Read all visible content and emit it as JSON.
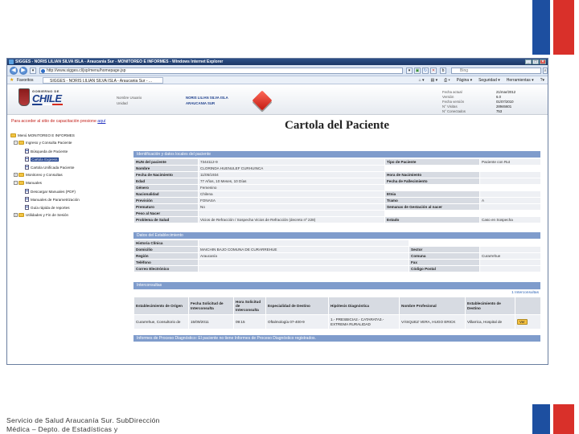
{
  "window": {
    "title": "SIGGES - NORIS LILIAN SILVA ISLA - Araucania Sur - MONITOREO E INFORMES - Windows Internet Explorer",
    "url": "http://www.sigges.cl/jsp/menu/homepage.jsp",
    "search_placeholder": "Bing",
    "mcafee": "McAfee",
    "favorites_label": "Favoritos",
    "tab_title": "SIGGES - NORIS LILIAN SILVA ISLA - Araucania Sur - ...",
    "commands": [
      "Página ▾",
      "Seguridad ▾",
      "Herramientas ▾"
    ]
  },
  "header": {
    "gobierno": "GOBIERNO DE",
    "chile": "CHILE",
    "usuario_label": "Nombre Usuario",
    "unidad_label": "Unidad",
    "usuario_value": "NORIS LILIAN SILVA ISLA",
    "unidad_value": "ARAUCANIA SUR",
    "info_labels": [
      "Fecha actual",
      "Versión",
      "Fecha versión",
      "N° Visitas",
      "N° Conectados"
    ],
    "info_values": [
      "21/mar/2012",
      "6.0",
      "01/07/2010",
      "28946601",
      "753"
    ]
  },
  "sidebar": {
    "capacitacion_text": "Para acceder al sitio de capacitación presione",
    "capacitacion_link": "aquí",
    "menu_title": "Menú MONITOREO E INFORMES",
    "items": [
      "Ingreso y Consulta Paciente",
      "Búsqueda de Paciente",
      "Cartola Express",
      "Cartola Unificada Paciente",
      "Monitoreo y Consultas",
      "Manuales",
      "Descargar Manuales (PDF)",
      "Manuales de Parametrización",
      "Guía rápida de reportes",
      "Utilidades y Fin de Sesión"
    ]
  },
  "main": {
    "title": "Cartola del Paciente",
    "id_section": "Identificación y datos locales del paciente",
    "id_rows": [
      [
        "RUN del paciente",
        "7344112-9",
        "Tipo de Paciente",
        "Paciente con Rut"
      ],
      [
        "Nombre",
        "CLORINDA HUENULEF CURHUINCA",
        "",
        ""
      ],
      [
        "Fecha de Nacimiento",
        "11/05/1934",
        "Hora de Nacimiento",
        ""
      ],
      [
        "Edad",
        "77 Años, 10 Meses, 10 Días",
        "Fecha de Fallecimiento",
        ""
      ],
      [
        "Género",
        "Femenino",
        "",
        ""
      ],
      [
        "Nacionalidad",
        "Chilena",
        "Etnia",
        ""
      ],
      [
        "Previsión",
        "FONASA",
        "Tramo",
        "A"
      ],
      [
        "Prematuro",
        "No",
        "Semanas de Gestación al nacer",
        ""
      ],
      [
        "Peso al Nacer",
        "",
        "",
        ""
      ],
      [
        "Problema de Salud",
        "Vicios de Refracción / Sospecha Vicios de Refracción (decreto nº 228)",
        "Estado",
        "Caso en Sospecha"
      ]
    ],
    "estab_section": "Datos del Establecimiento",
    "estab_rows": [
      [
        "Historia Clínica",
        "",
        "",
        ""
      ],
      [
        "Domicilio",
        "MAICHIN BAJO COMUNA DE CURARREHUE",
        "Sector",
        ""
      ],
      [
        "Región",
        "Araucanía",
        "Comuna",
        "Curarrehue"
      ],
      [
        "Teléfono",
        "",
        "Fax",
        ""
      ],
      [
        "Correo Electrónico",
        "",
        "Código Postal",
        ""
      ]
    ],
    "inter_section": "Interconsultas",
    "inter_count": "1 Interconsultas",
    "inter_headers": [
      "Establecimiento de Origen",
      "Fecha Solicitud de Interconsulta",
      "Hora Solicitud de Interconsulta",
      "Especialidad de Destino",
      "Hipótesis Diagnóstica",
      "Nombre Profesional",
      "Establecimiento de Destino",
      ""
    ],
    "inter_row": [
      "Curarrehue, Consultorio de",
      "15/09/2011",
      "09:15",
      "Oftalmología 07-400-9",
      "1.- PRESBICIA2.- CATARATA3.- EXTREMA RURALIDAD",
      "VÁSQUEZ VERA, HUGO ERICK",
      "Villarrica, Hospital de",
      "Ver"
    ],
    "proc_section": "Informes de Proceso Diagnóstico",
    "proc_note": ": El paciente no tiene Informes de Proceso Diagnóstico registrados."
  },
  "footer": {
    "line1": "Servicio de Salud Araucanía Sur. SubDirección",
    "line2": "Médica – Depto. de Estadísticas y"
  },
  "colors": {
    "flag_blue": "#1d4fa0",
    "flag_red": "#d9302a",
    "section_header": "#7f9ccc"
  }
}
